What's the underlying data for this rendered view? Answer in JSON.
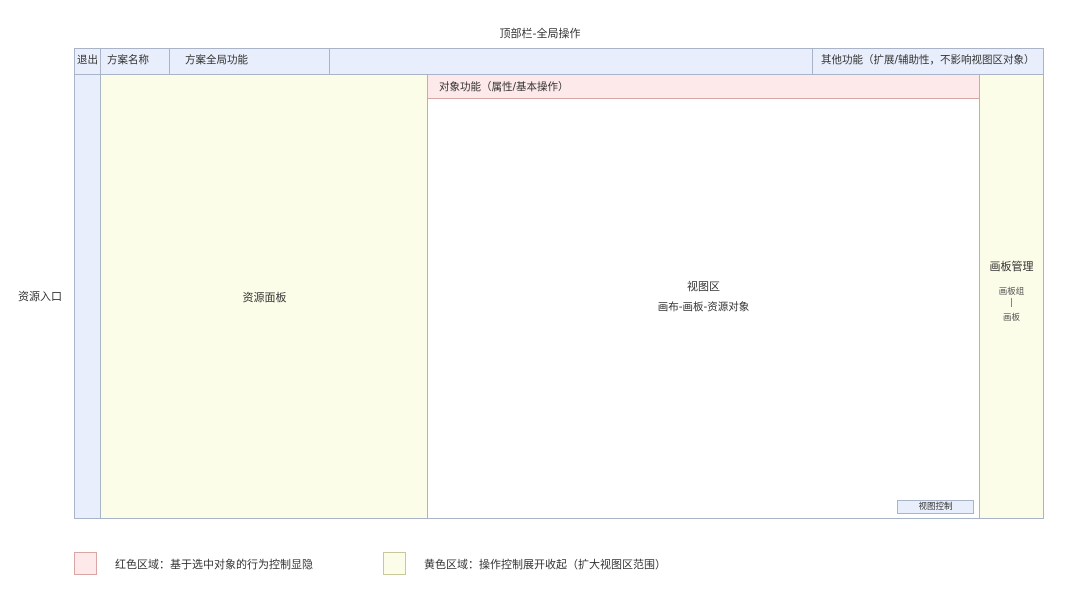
{
  "diagram": {
    "title": "顶部栏-全局操作",
    "resource_entry": "资源入口",
    "topbar": {
      "exit": "退出",
      "plan_name": "方案名称",
      "plan_global": "方案全局功能",
      "other": "其他功能（扩展/辅助性，不影响视图区对象）"
    },
    "resource_panel": "资源面板",
    "object_bar": "对象功能（属性/基本操作）",
    "view": {
      "title": "视图区",
      "subtitle": "画布-画板-资源对象",
      "control": "视图控制"
    },
    "board_mgmt": {
      "title": "画板管理",
      "group": "画板组",
      "sep": "|",
      "board": "画板"
    },
    "legend": {
      "red": "红色区域：基于选中对象的行为控制显隐",
      "yellow": "黄色区域：操作控制展开收起（扩大视图区范围）"
    },
    "colors": {
      "blue_region": "#e8eefb",
      "red_region": "#fde9e9",
      "yellow_region": "#fcfde8",
      "border": "#a9b4c8"
    }
  }
}
